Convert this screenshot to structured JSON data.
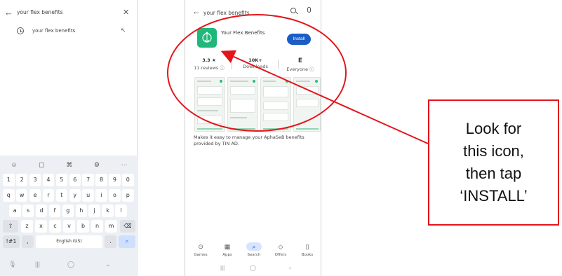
{
  "left_phone": {
    "search_query": "your flex benefits",
    "suggestion": "your flex benefits",
    "keyboard": {
      "toolbar": [
        "☺",
        "▢",
        "⚙",
        "⚙",
        "···"
      ],
      "number_row": [
        "1",
        "2",
        "3",
        "4",
        "5",
        "6",
        "7",
        "8",
        "9",
        "0"
      ],
      "row1": [
        "q",
        "w",
        "e",
        "r",
        "t",
        "y",
        "u",
        "i",
        "o",
        "p"
      ],
      "row2": [
        "a",
        "s",
        "d",
        "f",
        "g",
        "h",
        "j",
        "k",
        "l"
      ],
      "row3": [
        "z",
        "x",
        "c",
        "v",
        "b",
        "n",
        "m"
      ],
      "symbols_key": "!#1",
      "comma_key": ",",
      "space_label": "English (US)",
      "period_key": "."
    }
  },
  "right_phone": {
    "search_query": "your flex benefits",
    "app_name": "Your Flex Benefits",
    "install_label": "Install",
    "rating_value": "3.3 ★",
    "reviews_label": "11 reviews ⓘ",
    "downloads_value": "10K+",
    "downloads_label": "Downloads",
    "content_rating_value": "E",
    "content_rating_label": "Everyone ⓘ",
    "description": "Makes it easy to manage your AphaSeB benefits provided by TIN AD.",
    "bottom_nav": [
      {
        "icon": "gamepad-icon",
        "glyph": "⊙",
        "label": "Games",
        "active": false
      },
      {
        "icon": "apps-icon",
        "glyph": "▦",
        "label": "Apps",
        "active": false
      },
      {
        "icon": "search-icon",
        "glyph": "⌕",
        "label": "Search",
        "active": true
      },
      {
        "icon": "tag-icon",
        "glyph": "◇",
        "label": "Offers",
        "active": false
      },
      {
        "icon": "book-icon",
        "glyph": "▯",
        "label": "Books",
        "active": false
      }
    ],
    "system_nav": [
      "|||",
      "◯",
      "‹"
    ]
  },
  "annotation": {
    "callout_text": "Look for\nthis icon,\nthen tap\n‘INSTALL’",
    "color": "#e3151b"
  },
  "colors": {
    "app_icon": "#1fb87a",
    "install_button": "#1a5dc6",
    "keyboard_bg": "#eceff3"
  }
}
